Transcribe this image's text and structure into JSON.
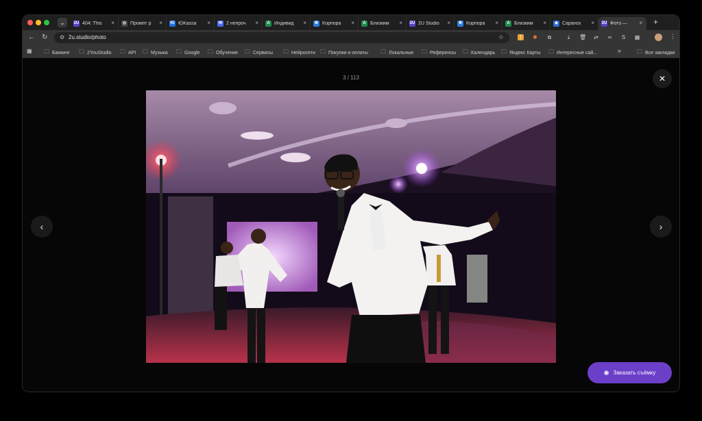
{
  "browser": {
    "tabs": [
      {
        "title": "404: This",
        "favicon": "2U",
        "color": "#5b3ec8"
      },
      {
        "title": "Промпт р",
        "favicon": "◎",
        "color": "#444444"
      },
      {
        "title": "ЮKassa",
        "favicon": "Ю",
        "color": "#1e6fe0"
      },
      {
        "title": "2 непроч",
        "favicon": "✉",
        "color": "#4a6cf0"
      },
      {
        "title": "Индивид",
        "favicon": "A",
        "color": "#1e8a4a"
      },
      {
        "title": "Корпора",
        "favicon": "✖",
        "color": "#2f7de1"
      },
      {
        "title": "Близким",
        "favicon": "A",
        "color": "#1e8a4a"
      },
      {
        "title": "2U Studio",
        "favicon": "2U",
        "color": "#5b3ec8"
      },
      {
        "title": "Корпора",
        "favicon": "✖",
        "color": "#2f7de1"
      },
      {
        "title": "Близким",
        "favicon": "A",
        "color": "#1e8a4a"
      },
      {
        "title": "Саранск",
        "favicon": "◆",
        "color": "#2f6fd0"
      },
      {
        "title": "Фото —",
        "favicon": "2U",
        "color": "#5b3ec8",
        "active": true
      }
    ],
    "url": "2u.studio/photo",
    "bookmarks": [
      {
        "label": "Банкинг"
      },
      {
        "label": "2YouStudio"
      },
      {
        "label": "API"
      },
      {
        "label": "Музыка"
      },
      {
        "label": "Google"
      },
      {
        "label": "Обучение"
      },
      {
        "label": "Сервисы"
      },
      {
        "label": "Нейросети"
      },
      {
        "label": "Покупки и оплаты"
      },
      {
        "label": "Локальные"
      },
      {
        "label": "Референсы"
      },
      {
        "label": "Календарь"
      },
      {
        "label": "Яндекс Карты"
      },
      {
        "label": "Интересные сай..."
      }
    ],
    "all_bookmarks_label": "Все закладки"
  },
  "viewer": {
    "counter": "3 / 113",
    "order_button_label": "Заказать съёмку",
    "accent_color": "#6c3fc9"
  }
}
